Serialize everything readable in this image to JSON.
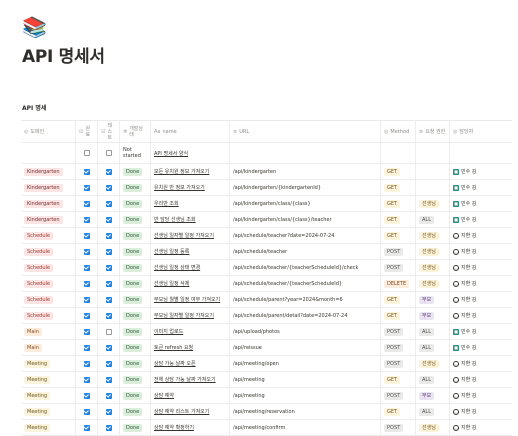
{
  "page": {
    "icon": "📚",
    "title": "API 명세서"
  },
  "database": {
    "title": "API 명세"
  },
  "columns": [
    {
      "icon": "◎",
      "label": "도메인"
    },
    {
      "icon": "☑",
      "label": "완료"
    },
    {
      "icon": "☑",
      "label": "테스트"
    },
    {
      "icon": "✲",
      "label": "개발상태"
    },
    {
      "icon": "Aa",
      "label": "name"
    },
    {
      "icon": "≡",
      "label": "URL"
    },
    {
      "icon": "◎",
      "label": "Method"
    },
    {
      "icon": "≡",
      "label": "요청 권한"
    },
    {
      "icon": "◎",
      "label": "담당자"
    }
  ],
  "first_row": {
    "status": "Not started",
    "name": "API 명세서 양식"
  },
  "rows": [
    {
      "domain": "Kindergarten",
      "dclass": "t-kind",
      "done": true,
      "test": true,
      "status": "Done",
      "name": "모든 유치원 정보 가져오기",
      "url": "/api/kindergarten",
      "method": "GET",
      "mclass": "t-get",
      "role": "",
      "rclass": "",
      "person": "민수 김",
      "ptype": "a1"
    },
    {
      "domain": "Kindergarten",
      "dclass": "t-kind",
      "done": true,
      "test": true,
      "status": "Done",
      "name": "유치원 반 정보 가져오기",
      "url": "/api/kindergarten/{kindergartenId}",
      "method": "GET",
      "mclass": "t-get",
      "role": "",
      "rclass": "",
      "person": "민수 김",
      "ptype": "a1"
    },
    {
      "domain": "Kindergarten",
      "dclass": "t-kind",
      "done": true,
      "test": true,
      "status": "Done",
      "name": "우리반 조회",
      "url": "/api/kindergarten/class/{class}",
      "method": "GET",
      "mclass": "t-get",
      "role": "선생님",
      "rclass": "t-role-t",
      "person": "민수 김",
      "ptype": "a1"
    },
    {
      "domain": "Kindergarten",
      "dclass": "t-kind",
      "done": true,
      "test": true,
      "status": "Done",
      "name": "반 담당 선생님 조회",
      "url": "/api/kindergarten/class/{class}/teacher",
      "method": "GET",
      "mclass": "t-get",
      "role": "ALL",
      "rclass": "t-role-all",
      "person": "민수 김",
      "ptype": "a1"
    },
    {
      "domain": "Schedule",
      "dclass": "t-sched",
      "done": true,
      "test": true,
      "status": "Done",
      "name": "선생님 일자별 일정 가져오기",
      "url": "/api/schedule/teacher?date=2024-07-24",
      "method": "GET",
      "mclass": "t-get",
      "role": "선생님",
      "rclass": "t-role-t",
      "person": "지환 김",
      "ptype": "a2"
    },
    {
      "domain": "Schedule",
      "dclass": "t-sched",
      "done": true,
      "test": true,
      "status": "Done",
      "name": "선생님 일정 등록",
      "url": "/api/schedule/teacher",
      "method": "POST",
      "mclass": "t-post",
      "role": "선생님",
      "rclass": "t-role-t",
      "person": "지환 김",
      "ptype": "a2"
    },
    {
      "domain": "Schedule",
      "dclass": "t-sched",
      "done": true,
      "test": true,
      "status": "Done",
      "name": "선생님 일정 상태 변경",
      "url": "/api/schedule/teacher/{teacherScheduleId}/check",
      "method": "POST",
      "mclass": "t-post",
      "role": "선생님",
      "rclass": "t-role-t",
      "person": "지환 김",
      "ptype": "a2"
    },
    {
      "domain": "Schedule",
      "dclass": "t-sched",
      "done": true,
      "test": true,
      "status": "Done",
      "name": "선생님 일정 삭제",
      "url": "/api/schedule/teacher/{teacherScheduleId}",
      "method": "DELETE",
      "mclass": "t-delete",
      "role": "선생님",
      "rclass": "t-role-t",
      "person": "지환 김",
      "ptype": "a2"
    },
    {
      "domain": "Schedule",
      "dclass": "t-sched",
      "done": true,
      "test": true,
      "status": "Done",
      "name": "부모님 월별 일정 여부 가져오기",
      "url": "/api/schedule/parent?year=2024&month=6",
      "method": "GET",
      "mclass": "t-get",
      "role": "부모",
      "rclass": "t-role-p",
      "person": "지환 김",
      "ptype": "a2"
    },
    {
      "domain": "Schedule",
      "dclass": "t-sched",
      "done": true,
      "test": true,
      "status": "Done",
      "name": "부모님 일자별 일정 가져오기",
      "url": "/api/schedule/parent/detail?date=2024-07-24",
      "method": "GET",
      "mclass": "t-get",
      "role": "부모",
      "rclass": "t-role-p",
      "person": "지환 김",
      "ptype": "a2"
    },
    {
      "domain": "Main",
      "dclass": "t-main",
      "done": true,
      "test": false,
      "status": "Done",
      "name": "이미지 업로드",
      "url": "/api/upload/photos",
      "method": "POST",
      "mclass": "t-post",
      "role": "ALL",
      "rclass": "t-role-all",
      "person": "민수 김",
      "ptype": "a1"
    },
    {
      "domain": "Main",
      "dclass": "t-main",
      "done": true,
      "test": true,
      "status": "Done",
      "name": "토큰 refresh 요청",
      "url": "/api/reissue",
      "method": "POST",
      "mclass": "t-post",
      "role": "ALL",
      "rclass": "t-role-all",
      "person": "민수 김",
      "ptype": "a1"
    },
    {
      "domain": "Meeting",
      "dclass": "t-meet",
      "done": true,
      "test": true,
      "status": "Done",
      "name": "상담 가능 날짜 오픈",
      "url": "/api/meeting/open",
      "method": "POST",
      "mclass": "t-post",
      "role": "선생님",
      "rclass": "t-role-t",
      "person": "지환 김",
      "ptype": "a2"
    },
    {
      "domain": "Meeting",
      "dclass": "t-meet",
      "done": true,
      "test": true,
      "status": "Done",
      "name": "전체 상담 가능 날짜 가져오기",
      "url": "/api/meeting",
      "method": "GET",
      "mclass": "t-get",
      "role": "ALL",
      "rclass": "t-role-all",
      "person": "지환 김",
      "ptype": "a2"
    },
    {
      "domain": "Meeting",
      "dclass": "t-meet",
      "done": true,
      "test": true,
      "status": "Done",
      "name": "상담 예약",
      "url": "/api/meeting",
      "method": "POST",
      "mclass": "t-post",
      "role": "부모",
      "rclass": "t-role-p",
      "person": "지환 김",
      "ptype": "a2"
    },
    {
      "domain": "Meeting",
      "dclass": "t-meet",
      "done": true,
      "test": true,
      "status": "Done",
      "name": "상담 예약 리스트 가져오기",
      "url": "/api/meeting/reservation",
      "method": "GET",
      "mclass": "t-get",
      "role": "ALL",
      "rclass": "t-role-all",
      "person": "지환 김",
      "ptype": "a2"
    },
    {
      "domain": "Meeting",
      "dclass": "t-meet",
      "done": true,
      "test": true,
      "status": "Done",
      "name": "상담 예약 확정하기",
      "url": "/api/meeting/confirm",
      "method": "POST",
      "mclass": "t-post",
      "role": "선생님",
      "rclass": "t-role-t",
      "person": "지환 김",
      "ptype": "a2"
    }
  ]
}
